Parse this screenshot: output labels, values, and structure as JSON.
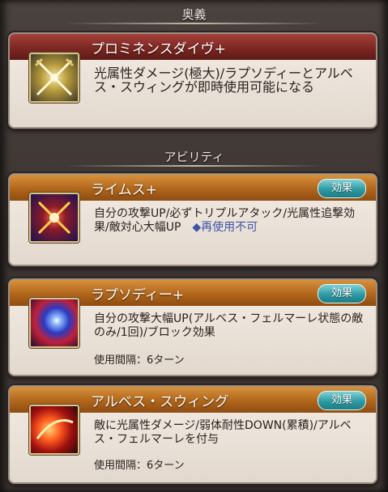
{
  "ougi": {
    "header": "奥義",
    "name": "プロミネンスダイヴ+",
    "icon": "crossed-swords-icon",
    "description": "光属性ダメージ(極大)/ラプソディーとアルベス・スウィングが即時使用可能になる"
  },
  "abilities_header": "アビリティ",
  "effect_label": "効果",
  "abilities": [
    {
      "name": "ライムス+",
      "icon": "crossed-swords-burst-icon",
      "description": "自分の攻撃UP/必ずトリプルアタック/光属性追撃効果/敵対心大幅UP",
      "tag": "◆再使用不可",
      "cooldown": ""
    },
    {
      "name": "ラプソディー+",
      "icon": "vortex-icon",
      "description": "自分の攻撃大幅UP(アルベス・フェルマーレ状態の敵のみ/1回)/ブロック効果",
      "tag": "",
      "cooldown": "使用間隔：6ターン"
    },
    {
      "name": "アルベス・スウィング",
      "icon": "fire-slash-icon",
      "description": "敵に光属性ダメージ/弱体耐性DOWN(累積)/アルベス・フェルマーレを付与",
      "tag": "",
      "cooldown": "使用間隔：6ターン"
    }
  ]
}
